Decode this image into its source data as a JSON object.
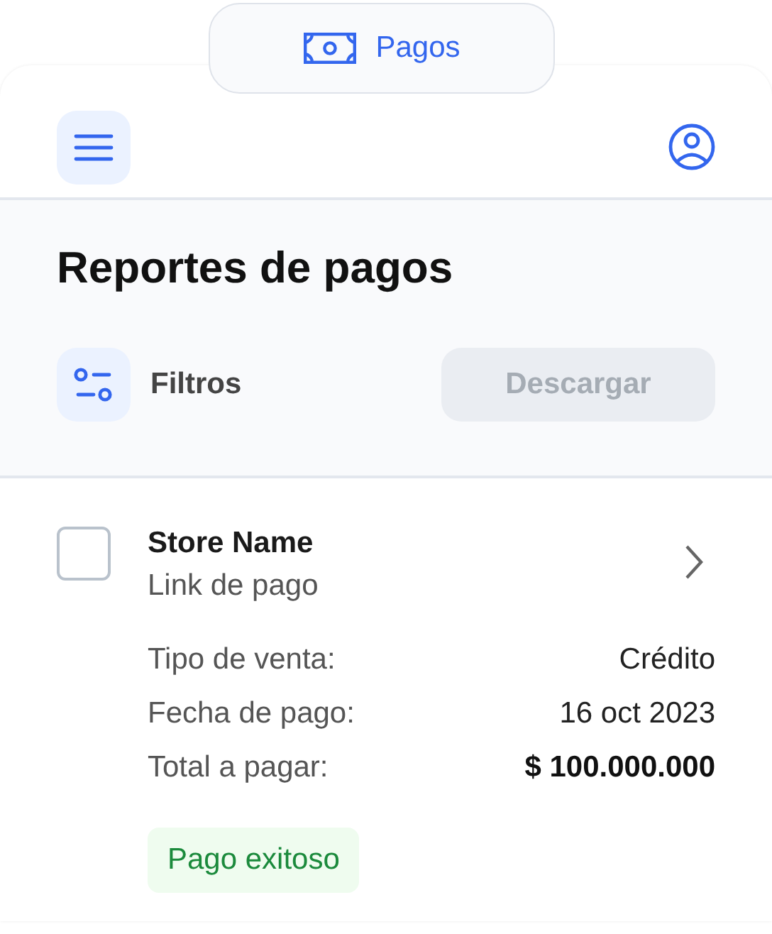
{
  "top_tab": {
    "label": "Pagos"
  },
  "title": "Reportes de pagos",
  "filters": {
    "label": "Filtros"
  },
  "download_button": {
    "label": "Descargar",
    "disabled": true
  },
  "payments": [
    {
      "store": "Store Name",
      "channel": "Link de pago",
      "checked": false,
      "details": [
        {
          "label": "Tipo de venta:",
          "value": "Crédito",
          "emphasis": false
        },
        {
          "label": "Fecha de pago:",
          "value": "16 oct 2023",
          "emphasis": false
        },
        {
          "label": "Total a pagar:",
          "value": "$ 100.000.000",
          "emphasis": true
        }
      ],
      "status": {
        "label": "Pago exitoso",
        "kind": "success"
      }
    }
  ]
}
